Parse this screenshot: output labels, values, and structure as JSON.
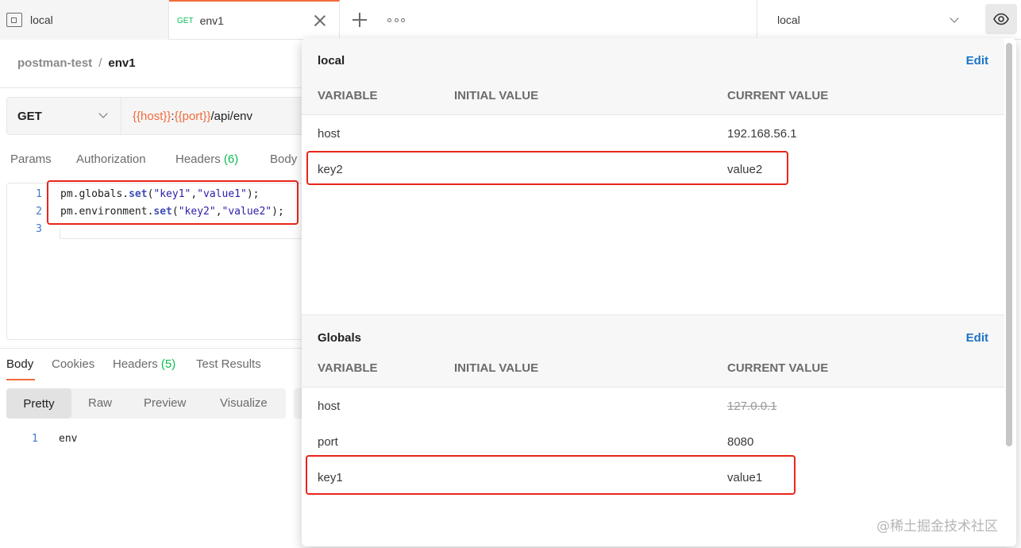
{
  "tabs": {
    "local_tab": {
      "label": "local"
    },
    "env1_tab": {
      "method": "GET",
      "label": "env1"
    }
  },
  "environment_selector": {
    "value": "local"
  },
  "icons": [
    "request-tab-icon",
    "close-icon",
    "plus-icon",
    "more-icon",
    "chevron-down-icon",
    "eye-icon"
  ],
  "breadcrumb": {
    "collection": "postman-test",
    "separator": "/",
    "request": "env1"
  },
  "request": {
    "method": "GET",
    "url_parts": [
      "{{host}}",
      ":",
      "{{port}}",
      "/api/env"
    ]
  },
  "request_tabs": {
    "params": "Params",
    "authorization": "Authorization",
    "headers": "Headers",
    "headers_count": "(6)",
    "body": "Body"
  },
  "script_editor": {
    "lines": [
      {
        "no": "1",
        "obj": "pm.globals.",
        "fn": "set",
        "open": "(",
        "k": "\"key1\"",
        "comma": ",",
        "v": "\"value1\"",
        "close": ");"
      },
      {
        "no": "2",
        "obj": "pm.environment.",
        "fn": "set",
        "open": "(",
        "k": "\"key2\"",
        "comma": ",",
        "v": "\"value2\"",
        "close": ");"
      },
      {
        "no": "3"
      }
    ]
  },
  "response_tabs": {
    "body": "Body",
    "cookies": "Cookies",
    "headers": "Headers",
    "headers_count": "(5)",
    "test_results": "Test Results"
  },
  "view_modes": {
    "pretty": "Pretty",
    "raw": "Raw",
    "preview": "Preview",
    "visualize": "Visualize"
  },
  "response_body": {
    "line_no": "1",
    "text": "env"
  },
  "quick_look": {
    "environment": {
      "title": "local",
      "edit": "Edit",
      "columns": {
        "variable": "VARIABLE",
        "initial": "INITIAL VALUE",
        "current": "CURRENT VALUE"
      },
      "rows": [
        {
          "variable": "host",
          "initial": "",
          "current": "192.168.56.1"
        },
        {
          "variable": "key2",
          "initial": "",
          "current": "value2"
        }
      ]
    },
    "globals": {
      "title": "Globals",
      "edit": "Edit",
      "columns": {
        "variable": "VARIABLE",
        "initial": "INITIAL VALUE",
        "current": "CURRENT VALUE"
      },
      "rows": [
        {
          "variable": "host",
          "initial": "",
          "current": "127.0.0.1",
          "overridden": true
        },
        {
          "variable": "port",
          "initial": "",
          "current": "8080"
        },
        {
          "variable": "key1",
          "initial": "",
          "current": "value1"
        }
      ]
    }
  },
  "colors": {
    "accent": "#f26b3a",
    "edit_link": "#1a73c8",
    "highlight": "#e8261b",
    "count": "#0cbb52"
  },
  "watermark": "@稀土掘金技术社区"
}
